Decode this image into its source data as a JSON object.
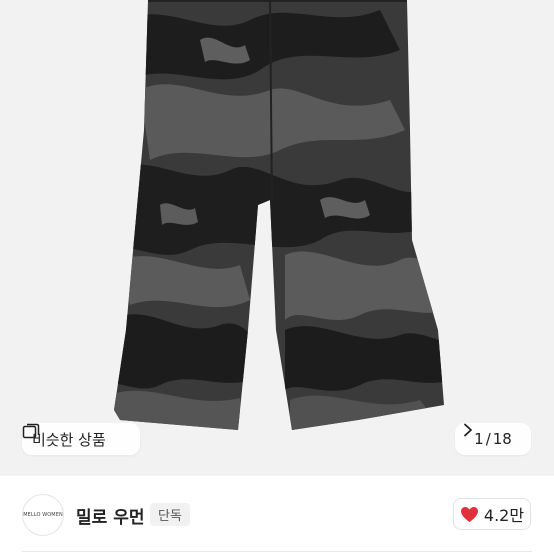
{
  "gallery": {
    "similar_label": "비슷한 상품",
    "current_index": "1",
    "total_count": "18",
    "image_colors": {
      "background": "#f2f2f2",
      "camo_base": "#3b3b3b",
      "camo_dark": "#1e1e1e",
      "camo_light": "#5a5a5a"
    },
    "icons": {
      "similar": "gallery-icon",
      "next": "chevron-right-icon"
    }
  },
  "seller": {
    "logo_text": "MELLO WOMEN",
    "name": "밀로 우먼",
    "badge": "단독",
    "likes": "4.2만",
    "like_color": "#e0313f",
    "like_icon": "heart-icon"
  }
}
